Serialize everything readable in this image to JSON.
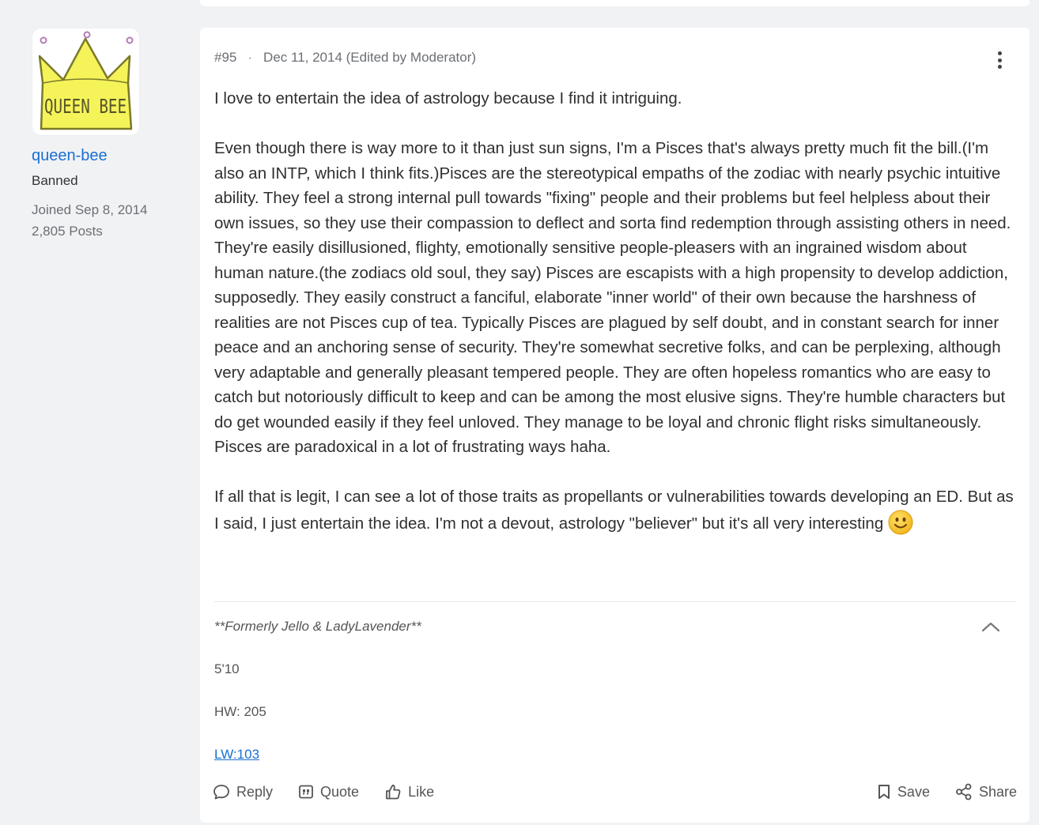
{
  "user": {
    "username": "queen-bee",
    "role": "Banned",
    "joined": "Joined Sep 8, 2014",
    "posts": "2,805 Posts",
    "avatar_text": "QUEEN BEE"
  },
  "post": {
    "number": "#95",
    "separator": "·",
    "date": "Dec 11, 2014 (Edited by Moderator)",
    "paragraphs": [
      "I love to entertain the idea of astrology because I find it intriguing.",
      "Even though there is way more to it than just sun signs, I'm a Pisces that's always pretty much fit the bill.(I'm also an INTP, which I think fits.)Pisces are the stereotypical empaths of the zodiac with nearly psychic intuitive ability. They feel a strong internal pull towards \"fixing\" people and their problems but feel helpless about their own issues, so they use their compassion to deflect and sorta find redemption through assisting others in need. They're easily disillusioned, flighty, emotionally sensitive people-pleasers with an ingrained wisdom about human nature.(the zodiacs old soul, they say) Pisces are escapists with a high propensity to develop addiction, supposedly. They easily construct a fanciful, elaborate \"inner world\" of their own because the harshness of realities are not Pisces cup of tea. Typically Pisces are plagued by self doubt, and in constant search for inner peace and an anchoring sense of security. They're somewhat secretive folks, and can be perplexing, although very adaptable and generally pleasant tempered people. They are often hopeless romantics who are easy to catch but notoriously difficult to keep and can be among the most elusive signs. They're humble characters but do get wounded easily if they feel unloved. They manage to be loyal and chronic flight risks simultaneously. Pisces are paradoxical in a lot of frustrating ways haha.",
      "If all that is legit, I can see a lot of those traits as propellants or vulnerabilities towards developing an ED. But as I said, I just entertain the idea. I'm not a devout, astrology \"believer\" but it's all very interesting"
    ]
  },
  "signature": {
    "title": "**Formerly Jello & LadyLavender**",
    "lines": [
      "5'10",
      "HW: 205",
      "LW:103"
    ]
  },
  "actions": {
    "reply": "Reply",
    "quote": "Quote",
    "like": "Like",
    "save": "Save",
    "share": "Share"
  },
  "colors": {
    "link": "#1a6fd1",
    "page_bg": "#f1f2f4",
    "crown_fill": "#f5f35a"
  }
}
